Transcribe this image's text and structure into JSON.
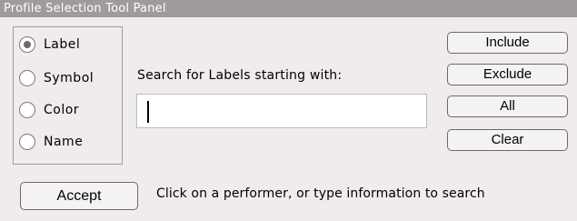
{
  "panel": {
    "title": "Profile Selection Tool Panel"
  },
  "search_mode": {
    "options": [
      {
        "label": "Label",
        "selected": true
      },
      {
        "label": "Symbol",
        "selected": false
      },
      {
        "label": "Color",
        "selected": false
      },
      {
        "label": "Name",
        "selected": false
      }
    ]
  },
  "search": {
    "label": "Search for Labels starting with:",
    "value": ""
  },
  "actions": {
    "include_label": "Include",
    "exclude_label": "Exclude",
    "all_label": "All",
    "clear_label": "Clear"
  },
  "footer": {
    "accept_label": "Accept",
    "status": "Click on a performer, or type information to search"
  }
}
